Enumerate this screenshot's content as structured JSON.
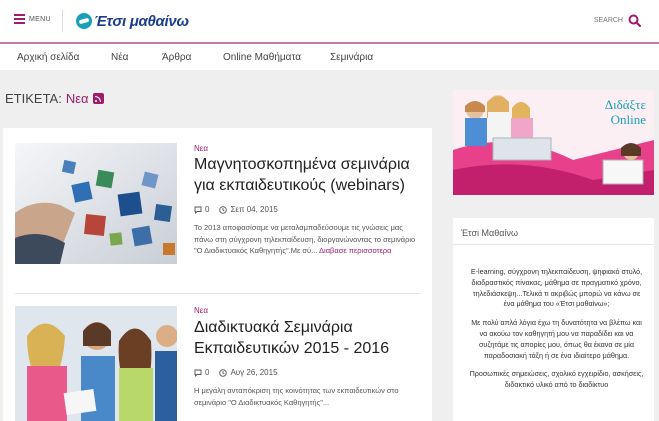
{
  "header": {
    "menu_label": "MENU",
    "logo_text": "Έτσι μαθαίνω",
    "search_label": "SEARCH"
  },
  "nav": {
    "items": [
      {
        "label": "Αρχική σελίδα"
      },
      {
        "label": "Νέα"
      },
      {
        "label": "Άρθρα"
      },
      {
        "label": "Online Μαθήματα"
      },
      {
        "label": "Σεμινάρια"
      }
    ]
  },
  "tag": {
    "prefix": "ΕΤΙΚΕΤΑ:",
    "value": "Νεα"
  },
  "articles": [
    {
      "category": "Νεα",
      "title": "Μαγνητοσκοπημένα σεμινάρια για εκπαιδευτικούς (webinars)",
      "comments": "0",
      "date": "Σεπ 04, 2015",
      "excerpt": "Το 2013 αποφασίσαμε να μεταλαμπαδεύσουμε τις γνώσεις μας πάνω στη σύγχρονη τηλεκπαίδευση, διοργανώνοντας το σεμινάριο \"Ο Διαδικτυακός Καθηγητής\".Με σύ...",
      "read_more": "Διαβασε περισσοτερα"
    },
    {
      "category": "Νεα",
      "title": "Διαδικτυακά Σεμινάρια Εκπαιδευτικών 2015 - 2016",
      "comments": "0",
      "date": "Αυγ 26, 2015",
      "excerpt": "Η μεγάλη ανταπόκριση της κοινότητας των εκπαιδευτικών στο σεμινάριο \"Ο Διαδικτυακός Καθηγητής\"..."
    }
  ],
  "sidebar": {
    "ad_line1": "Διδάξτε",
    "ad_line2": "Online",
    "widget_title": "Έτσι Μαθαίνω",
    "widget_p1": "E-learning, σύγχρονη τηλεκπαίδευση, ψηφιακό στυλό, διαδραστικός πίνακας, μάθημα σε πραγματικό χρόνο, τηλεδιάσκεψη...Τελικά τι ακριβώς μπορώ να κάνω σε ένα μάθημα του «Έτσι μαθαίνω»;",
    "widget_p2": "Με πολύ απλά λόγια έχω τη δυνατότητα να βλέπω και να ακούω τον καθηγητή μου να παραδίδει και να συζητάμε τις απορίες μου, όπως θα έκανα σε μία παραδοσιακή τάξη ή σε ένα ιδιαίτερο μάθημα.",
    "widget_p3": "Προσωπικές σημειώσεις, σχολικό εγχειρίδιο, ασκήσεις, διδακτικό υλικό από το διαδίκτυο"
  },
  "colors": {
    "accent": "#a01c6b",
    "logo_blue": "#1b3f8f",
    "teal": "#1aa0b8",
    "background": "#efefef"
  }
}
